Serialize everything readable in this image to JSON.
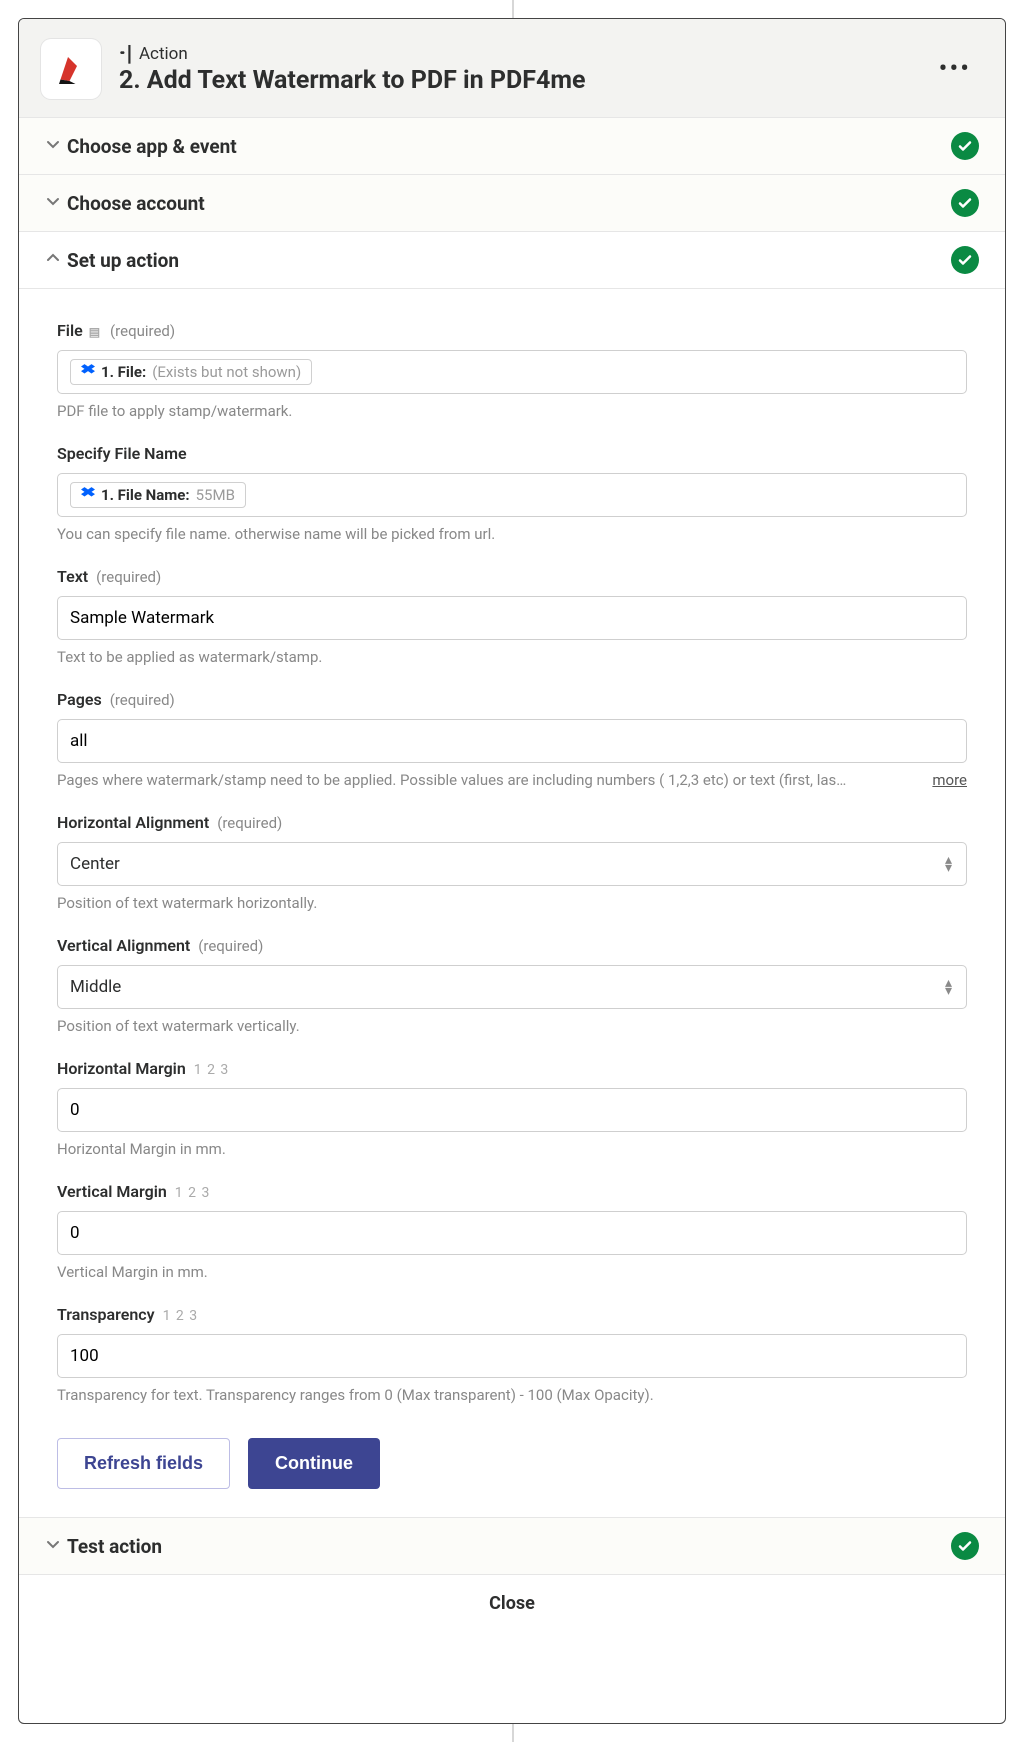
{
  "header": {
    "kicker_label": "Action",
    "title": "2. Add Text Watermark to PDF in PDF4me"
  },
  "sections": {
    "choose_app": "Choose app & event",
    "choose_account": "Choose account",
    "setup_action": "Set up action",
    "test_action": "Test action"
  },
  "fields": {
    "file": {
      "label": "File",
      "required": "(required)",
      "pill_prefix": "1. File:",
      "pill_value": "(Exists but not shown)",
      "helper": "PDF file to apply stamp/watermark."
    },
    "filename": {
      "label": "Specify File Name",
      "pill_prefix": "1. File Name:",
      "pill_value": "55MB",
      "helper": "You can specify file name. otherwise name will be picked from url."
    },
    "text": {
      "label": "Text",
      "required": "(required)",
      "value": "Sample Watermark",
      "helper": "Text to be applied as watermark/stamp."
    },
    "pages": {
      "label": "Pages",
      "required": "(required)",
      "value": "all",
      "helper": "Pages where watermark/stamp need to be applied. Possible values are including numbers ( 1,2,3 etc) or text (first, las…",
      "more": "more"
    },
    "halign": {
      "label": "Horizontal Alignment",
      "required": "(required)",
      "value": "Center",
      "helper": "Position of text watermark horizontally."
    },
    "valign": {
      "label": "Vertical Alignment",
      "required": "(required)",
      "value": "Middle",
      "helper": "Position of text watermark vertically."
    },
    "hmargin": {
      "label": "Horizontal Margin",
      "hint123": "1 2 3",
      "value": "0",
      "helper": "Horizontal Margin in mm."
    },
    "vmargin": {
      "label": "Vertical Margin",
      "hint123": "1 2 3",
      "value": "0",
      "helper": "Vertical Margin in mm."
    },
    "transparency": {
      "label": "Transparency",
      "hint123": "1 2 3",
      "value": "100",
      "helper": "Transparency for text. Transparency ranges from 0 (Max transparent) - 100 (Max Opacity)."
    }
  },
  "buttons": {
    "refresh": "Refresh fields",
    "continue": "Continue",
    "close": "Close"
  }
}
